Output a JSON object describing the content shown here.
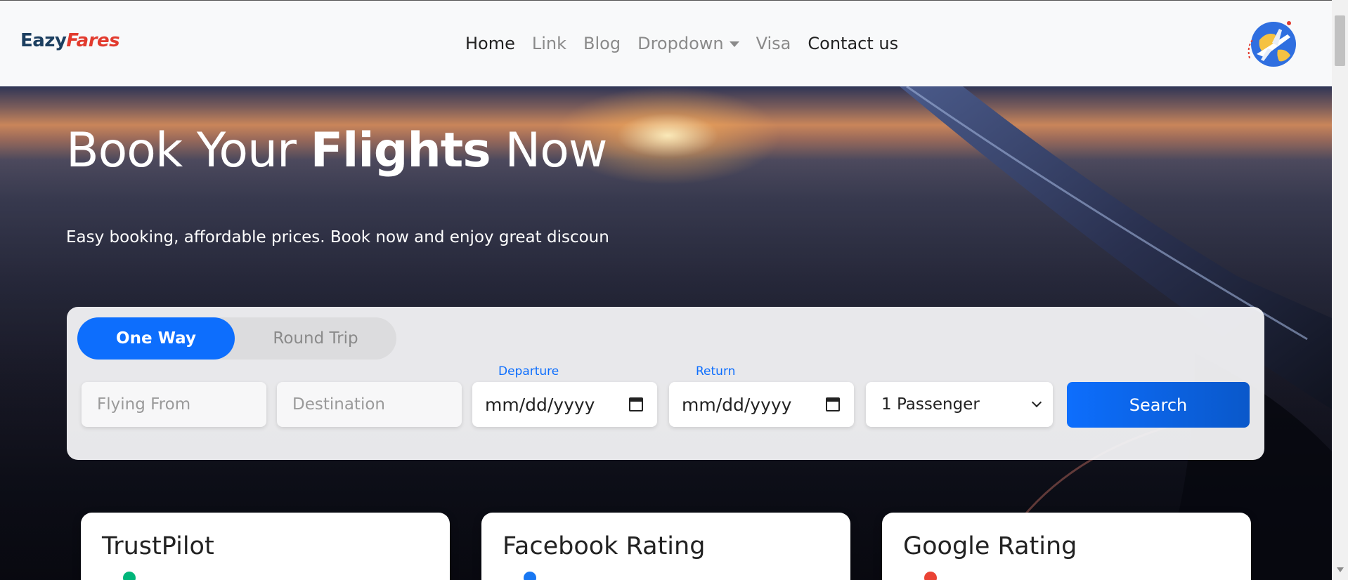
{
  "navbar": {
    "logo_part1": "Eazy",
    "logo_part2": "Fares",
    "links": [
      {
        "label": "Home",
        "active": true
      },
      {
        "label": "Link",
        "active": false
      },
      {
        "label": "Blog",
        "active": false
      },
      {
        "label": "Dropdown",
        "active": false
      },
      {
        "label": "Visa",
        "active": false
      },
      {
        "label": "Contact us",
        "active": true
      }
    ]
  },
  "hero": {
    "title_part1": "Book Your ",
    "title_bold": "Flights",
    "title_part2": " Now",
    "subtitle": "Easy booking, affordable prices. Book now and enjoy great discoun"
  },
  "search": {
    "trip_types": {
      "one_way": "One Way",
      "round_trip": "Round Trip"
    },
    "from_placeholder": "Flying From",
    "destination_placeholder": "Destination",
    "departure_label": "Departure",
    "return_label": "Return",
    "departure_value": "mm/dd/yyyy",
    "return_value": "mm/dd/yyyy",
    "passengers_selected": "1 Passenger",
    "search_label": "Search"
  },
  "ratings": [
    {
      "title": "TrustPilot",
      "icon": "trustpilot-star-icon",
      "color": "#00b67a"
    },
    {
      "title": "Facebook Rating",
      "icon": "facebook-icon",
      "color": "#1877f2"
    },
    {
      "title": "Google Rating",
      "icon": "google-icon",
      "color": "#ea4335"
    }
  ],
  "colors": {
    "primary": "#0d6efd",
    "logo_dark": "#1c3f60",
    "logo_accent": "#e23b2e"
  }
}
